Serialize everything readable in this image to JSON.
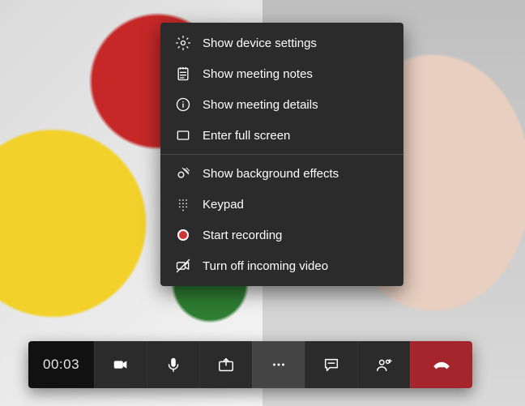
{
  "menu": {
    "group1": [
      {
        "label": "Show device settings"
      },
      {
        "label": "Show meeting notes"
      },
      {
        "label": "Show meeting details"
      },
      {
        "label": "Enter full screen"
      }
    ],
    "group2": [
      {
        "label": "Show background effects"
      },
      {
        "label": "Keypad"
      },
      {
        "label": "Start recording"
      },
      {
        "label": "Turn off incoming video"
      }
    ]
  },
  "toolbar": {
    "timer": "00:03"
  },
  "colors": {
    "menu_bg": "#2b2b2b",
    "hangup": "#a4262c",
    "record": "#d13438"
  }
}
